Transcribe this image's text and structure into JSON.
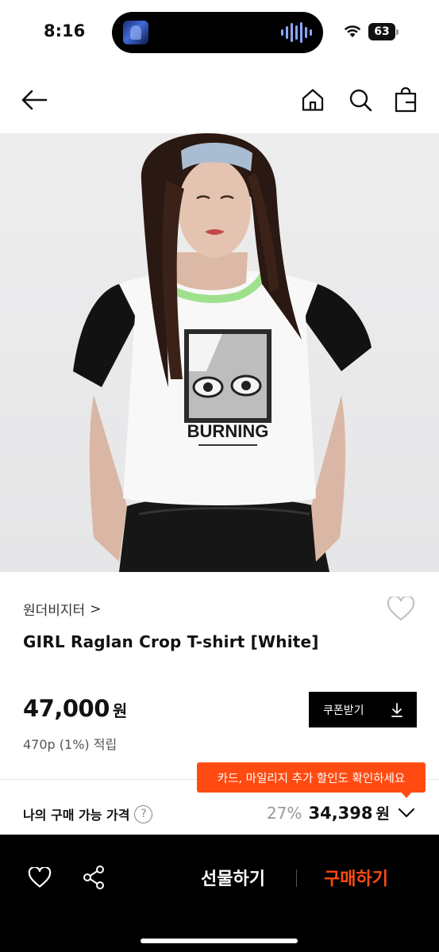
{
  "status_bar": {
    "time": "8:16",
    "battery": "63"
  },
  "nav": {
    "back_icon": "arrow-left-icon",
    "home_icon": "home-icon",
    "search_icon": "search-icon",
    "bag_icon": "shopping-bag-icon"
  },
  "product": {
    "image_print_text": "BURNING",
    "brand": "원더비지터",
    "brand_chevron": ">",
    "title": "GIRL Raglan Crop T-shirt [White]",
    "price": "47,000",
    "price_unit": "원",
    "points": "470p (1%) 적립"
  },
  "coupon_button": {
    "label": "쿠폰받기"
  },
  "tooltip": {
    "text": "카드, 마일리지 추가 할인도 확인하세요"
  },
  "my_price": {
    "label": "나의 구매 가능 가격",
    "help": "?",
    "discount": "27%",
    "price": "34,398",
    "unit": "원"
  },
  "bottom_bar": {
    "gift_label": "선물하기",
    "separator": "|",
    "buy_label": "구매하기"
  },
  "colors": {
    "accent": "#ff4b12",
    "bottom_bar": "#000000",
    "coupon_button": "#000000"
  }
}
